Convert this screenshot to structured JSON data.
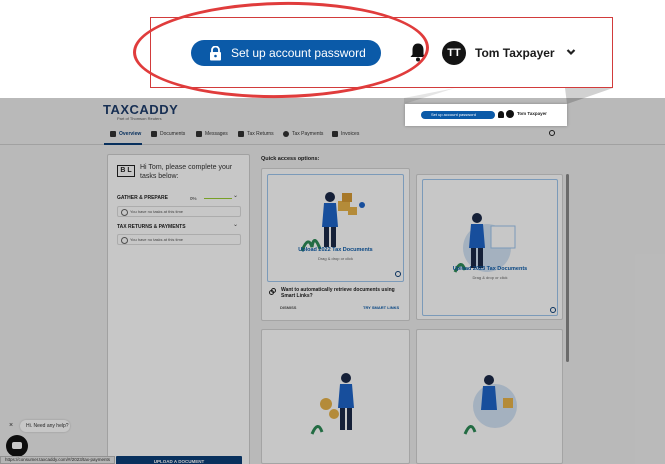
{
  "zoom": {
    "password_button_label": "Set up account password",
    "avatar_initials": "TT",
    "user_name": "Tom Taxpayer"
  },
  "app": {
    "logo_text": "TAXCADDY",
    "logo_subtext": "Part of Thomson Reuters",
    "header": {
      "password_button_label": "Set up account password",
      "user_name": "Tom Taxpayer"
    },
    "tabs": [
      {
        "label": "Overview",
        "icon": "home-icon"
      },
      {
        "label": "Documents",
        "icon": "documents-icon"
      },
      {
        "label": "Messages",
        "icon": "messages-icon"
      },
      {
        "label": "Tax Returns",
        "icon": "tax-returns-icon"
      },
      {
        "label": "Tax Payments",
        "icon": "dollar-icon"
      },
      {
        "label": "Invoices",
        "icon": "invoice-icon"
      }
    ],
    "left_panel": {
      "badge": "B L",
      "greeting": "Hi Tom, please complete your tasks below:",
      "gather_title": "GATHER & PREPARE",
      "gather_pct": "0%",
      "gather_empty": "You have no tasks at this time",
      "returns_title": "TAX RETURNS & PAYMENTS",
      "returns_empty": "You have no tasks at this time",
      "upload_button": "UPLOAD A DOCUMENT"
    },
    "quick_access_title": "Quick access options:",
    "cards": [
      {
        "title": "Upload 2022 Tax Documents",
        "subtitle": "Drag & drop or click"
      },
      {
        "title": "Upload 2023 Tax Documents",
        "subtitle": "Drag & drop or click"
      }
    ],
    "smart_links": {
      "text": "Want to automatically retrieve documents using Smart Links?",
      "dismiss": "DISMISS",
      "try": "TRY SMART LINKS"
    },
    "chat": {
      "bubble": "Hi. Need any help?",
      "close": "×"
    },
    "status_url": "https://consumer.taxcaddy.com/#/2023/tax-payments"
  },
  "colors": {
    "brand_blue": "#0b5aa8",
    "navy": "#0b3e78",
    "highlight_red": "#e03c3c",
    "progress_green": "#9acd32"
  }
}
